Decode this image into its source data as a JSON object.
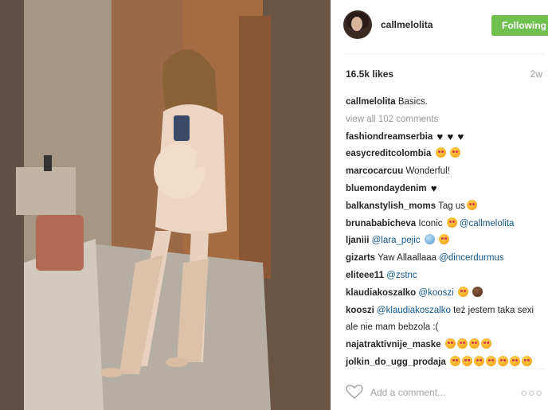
{
  "header": {
    "username": "callmelolita",
    "follow_label": "Following",
    "follow_color": "#70c050"
  },
  "likes": "16.5k likes",
  "time": "2w",
  "caption": {
    "user": "callmelolita",
    "text": "Basics."
  },
  "view_all": "view all 102 comments",
  "comments": [
    {
      "user": "fashiondreamserbia",
      "text": "",
      "emoji": [
        "heart-icon",
        "heart-icon",
        "heart-icon"
      ]
    },
    {
      "user": "easycreditcolombia",
      "text": "",
      "emoji": [
        "heart-eyes-icon",
        "heart-eyes-icon"
      ]
    },
    {
      "user": "marcocarcuu",
      "text": "Wonderful!",
      "emoji": []
    },
    {
      "user": "bluemondaydenim",
      "text": "",
      "emoji": [
        "heart-icon"
      ]
    },
    {
      "user": "balkanstylish_moms",
      "text": "Tag us",
      "emoji": [
        "heart-eyes-icon"
      ]
    },
    {
      "user": "brunababicheva",
      "text": "Iconic",
      "mention": "@callmelolita",
      "emoji_mid": [
        "heart-eyes-icon"
      ]
    },
    {
      "user": "ljaniii",
      "mention": "@lara_pejic",
      "emoji": [
        "scream-icon",
        "heart-eyes-icon"
      ]
    },
    {
      "user": "gizarts",
      "text": "Yaw Allaallaaa",
      "mention": "@dincerdurmus"
    },
    {
      "user": "eliteee11",
      "mention": "@zstnc"
    },
    {
      "user": "klaudiakoszalko",
      "mention": "@kooszi",
      "emoji": [
        "heart-eyes-icon",
        "see-no-evil-icon"
      ]
    },
    {
      "user": "kooszi",
      "mention": "@klaudiakoszalko",
      "text": "też jestem taka sexi ale nie mam bebzola :("
    },
    {
      "user": "najatraktivnije_maske",
      "text": "",
      "emoji": [
        "heart-eyes-icon",
        "heart-eyes-icon",
        "heart-eyes-icon",
        "heart-eyes-icon"
      ]
    },
    {
      "user": "jolkin_do_ugg_prodaja",
      "text": "",
      "emoji": [
        "heart-eyes-icon",
        "heart-eyes-icon",
        "heart-eyes-icon",
        "heart-eyes-icon",
        "heart-eyes-icon",
        "heart-eyes-icon",
        "heart-eyes-icon"
      ]
    }
  ],
  "add_comment_placeholder": "Add a comment...",
  "icons": {
    "like": "heart-outline-icon",
    "more": "more-options-icon"
  }
}
